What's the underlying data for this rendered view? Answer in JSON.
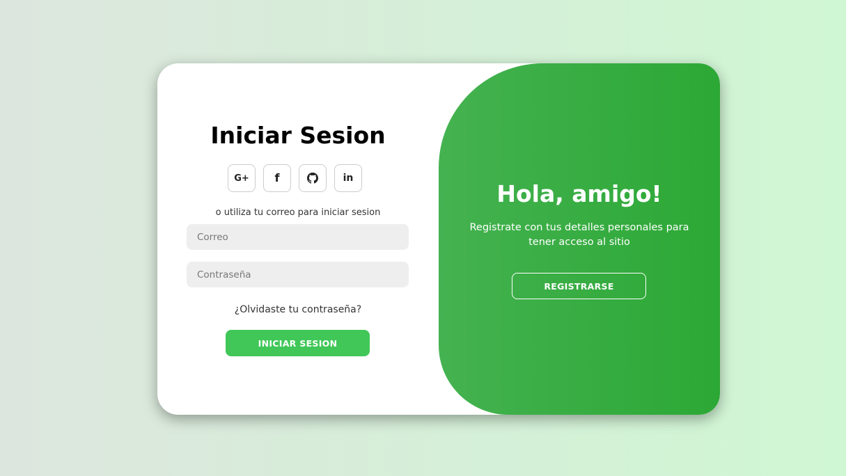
{
  "colors": {
    "accent_green": "#40c758",
    "panel_green_start": "#44b250",
    "panel_green_end": "#2ca835",
    "field_bg": "#eeeeee"
  },
  "signin": {
    "title": "Iniciar Sesion",
    "social": [
      {
        "icon": "google-plus-icon",
        "label": "G+"
      },
      {
        "icon": "facebook-icon",
        "label": "f"
      },
      {
        "icon": "github-icon",
        "label": ""
      },
      {
        "icon": "linkedin-icon",
        "label": "in"
      }
    ],
    "hint": "o utiliza tu correo para iniciar sesion",
    "email_placeholder": "Correo",
    "password_placeholder": "Contraseña",
    "forgot": "¿Olvidaste tu contraseña?",
    "button": "INICIAR SESION"
  },
  "panel": {
    "title": "Hola, amigo!",
    "text": "Registrate con tus detalles personales para tener acceso al sitio",
    "button": "REGISTRARSE"
  }
}
